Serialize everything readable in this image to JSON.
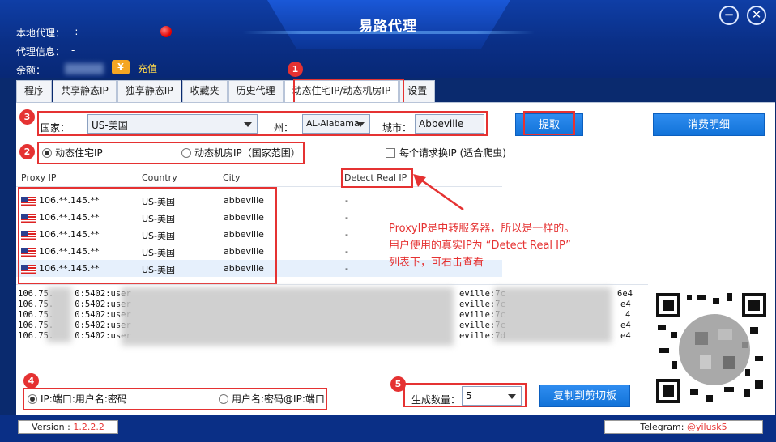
{
  "window": {
    "title": "易路代理",
    "minimize_glyph": "−",
    "close_glyph": "✕"
  },
  "info": {
    "local_proxy_label": "本地代理：",
    "local_proxy_value": "-:-",
    "proxy_info_label": "代理信息：",
    "proxy_info_value": "-",
    "balance_label": "余额：",
    "coin_glyph": "¥",
    "recharge_label": "充值",
    "status_color": "#e00000"
  },
  "tabs": [
    {
      "label": "程序"
    },
    {
      "label": "共享静态IP"
    },
    {
      "label": "独享静态IP"
    },
    {
      "label": "收藏夹"
    },
    {
      "label": "历史代理"
    },
    {
      "label": "动态住宅IP/动态机房IP"
    },
    {
      "label": "设置"
    }
  ],
  "filters": {
    "country_label": "国家：",
    "country_value": "US-美国",
    "state_label": "州：",
    "state_value": "AL-Alabama",
    "city_label": "城市：",
    "city_value": "Abbeville"
  },
  "buttons": {
    "extract": "提取",
    "consumption_detail": "消费明细",
    "copy_clipboard": "复制到剪切板"
  },
  "ip_type": {
    "residential": "动态住宅IP",
    "datacenter": "动态机房IP（国家范围）",
    "per_request": "每个请求换IP (适合爬虫)"
  },
  "table": {
    "headers": [
      "Proxy IP",
      "Country",
      "City",
      "Detect Real IP"
    ],
    "rows": [
      {
        "ip": "106.**.145.**",
        "country": "US-美国",
        "city": "abbeville",
        "real": "-"
      },
      {
        "ip": "106.**.145.**",
        "country": "US-美国",
        "city": "abbeville",
        "real": "-"
      },
      {
        "ip": "106.**.145.**",
        "country": "US-美国",
        "city": "abbeville",
        "real": "-"
      },
      {
        "ip": "106.**.145.**",
        "country": "US-美国",
        "city": "abbeville",
        "real": "-"
      },
      {
        "ip": "106.**.145.**",
        "country": "US-美国",
        "city": "abbeville",
        "real": "-"
      }
    ]
  },
  "annotation": {
    "line1": "ProxyIP是中转服务器，所以是一样的。",
    "line2": "用户使用的真实IP为 “Detect Real IP”",
    "line3": "列表下，可右击查看"
  },
  "output_lines": [
    {
      "a": "106.75.",
      "b": "0:5402:user",
      "c": "eville:7c",
      "d": "6e4"
    },
    {
      "a": "106.75.",
      "b": "0:5402:user",
      "c": "eville:7c",
      "d": "e4"
    },
    {
      "a": "106.75.",
      "b": "0:5402:user",
      "c": "eville:7c",
      "d": "4"
    },
    {
      "a": "106.75.",
      "b": "0:5402:user",
      "c": "eville:7c",
      "d": "e4"
    },
    {
      "a": "106.75.",
      "b": "0:5402:user",
      "c": "eville:7d",
      "d": "e4"
    }
  ],
  "format": {
    "opt1": "IP:端口:用户名:密码",
    "opt2": "用户名:密码@IP:端口",
    "count_label": "生成数量：",
    "count_value": "5"
  },
  "badges": [
    "1",
    "2",
    "3",
    "4",
    "5"
  ],
  "status": {
    "version_label": "Version : ",
    "version_value": "1.2.2.2",
    "telegram_label": "Telegram: ",
    "telegram_value": "@yilusk5"
  }
}
